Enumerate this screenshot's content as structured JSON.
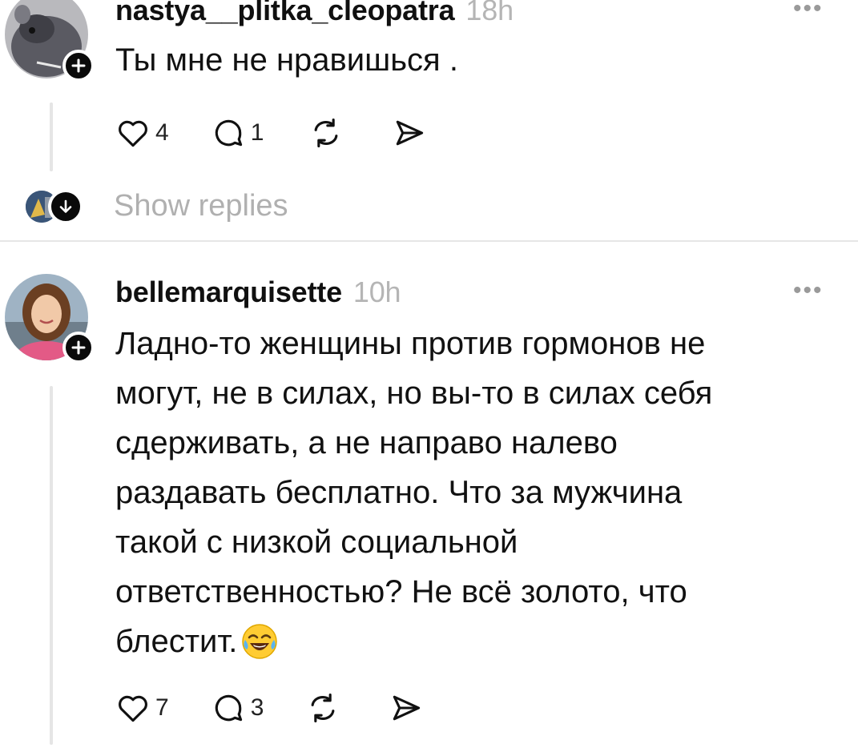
{
  "comments": [
    {
      "username": "nastya__plitka_cleopatra",
      "time": "18h",
      "text": "Ты мне не нравишься .",
      "likes": "4",
      "replies": "1",
      "more": "•••"
    },
    {
      "username": "bellemarquisette",
      "time": "10h",
      "text_lines": [
        "Ладно-то женщины против гормонов не",
        "могут, не в силах, но вы-то в силах себя",
        "сдерживать, а не направо налево",
        "раздавать бесплатно. Что за мужчина",
        "такой с низкой социальной",
        "ответственностью? Не всё золото, что",
        "блестит."
      ],
      "emoji_icon": "face-with-tears-of-joy",
      "likes": "7",
      "replies": "3",
      "more": "•••"
    }
  ],
  "show_replies_label": "Show replies",
  "icons": [
    "heart-icon",
    "comment-icon",
    "repost-icon",
    "share-icon",
    "plus-icon",
    "arrow-down-icon",
    "more-icon"
  ],
  "colors": {
    "text": "#101010",
    "muted": "#b0b0b0",
    "divider": "#e6e6e6",
    "badge": "#0a0a0a"
  }
}
